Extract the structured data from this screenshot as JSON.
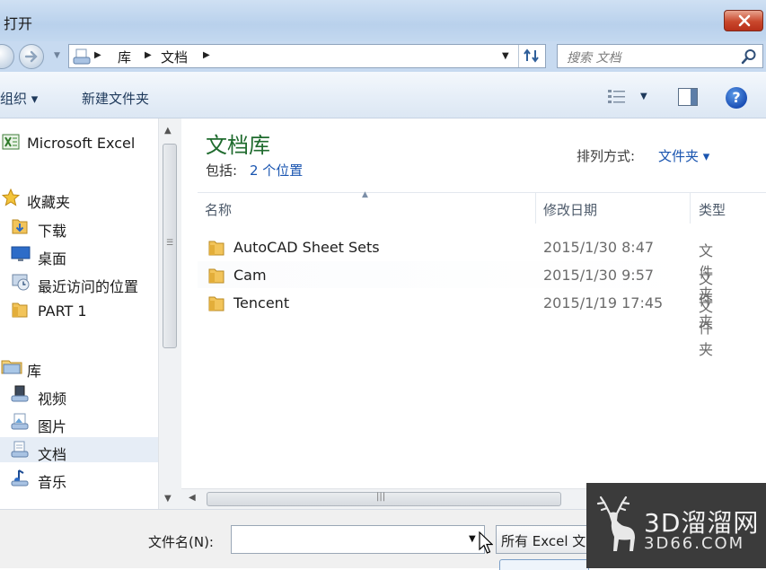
{
  "window": {
    "title": "打开"
  },
  "nav": {
    "breadcrumb": [
      "库",
      "文档"
    ],
    "search_placeholder": "搜索 文档"
  },
  "toolbar": {
    "organize_label": "组织 ▾",
    "new_folder_label": "新建文件夹"
  },
  "sidebar": {
    "items": [
      {
        "label": "Microsoft Excel",
        "icon": "excel-icon"
      },
      {
        "label": "收藏夹",
        "icon": "star-icon"
      },
      {
        "label": "下载",
        "icon": "download-folder-icon"
      },
      {
        "label": "桌面",
        "icon": "desktop-icon"
      },
      {
        "label": "最近访问的位置",
        "icon": "recent-places-icon"
      },
      {
        "label": "PART 1",
        "icon": "folder-icon"
      },
      {
        "label": "库",
        "icon": "library-icon"
      },
      {
        "label": "视频",
        "icon": "video-library-icon"
      },
      {
        "label": "图片",
        "icon": "pictures-library-icon"
      },
      {
        "label": "文档",
        "icon": "documents-library-icon",
        "selected": true
      },
      {
        "label": "音乐",
        "icon": "music-library-icon"
      }
    ]
  },
  "library": {
    "title": "文档库",
    "includes_label": "包括:",
    "includes_link": "2 个位置",
    "arrange_label": "排列方式:",
    "arrange_value": "文件夹 ▾"
  },
  "columns": {
    "name": "名称",
    "date": "修改日期",
    "type": "类型"
  },
  "files": [
    {
      "name": "AutoCAD Sheet Sets",
      "date": "2015/1/30 8:47",
      "type": "文件夹"
    },
    {
      "name": "Cam",
      "date": "2015/1/30 9:57",
      "type": "文件夹"
    },
    {
      "name": "Tencent",
      "date": "2015/1/19 17:45",
      "type": "文件夹"
    }
  ],
  "bottom": {
    "filename_label": "文件名(N):",
    "filename_value": "",
    "filetype": "所有 Excel 文"
  },
  "watermark": {
    "title": "3D溜溜网",
    "subtitle": "3D66.COM"
  },
  "colors": {
    "accent_link": "#1a55b0",
    "library_title": "#1f6b2e",
    "close_red": "#c9472c"
  }
}
